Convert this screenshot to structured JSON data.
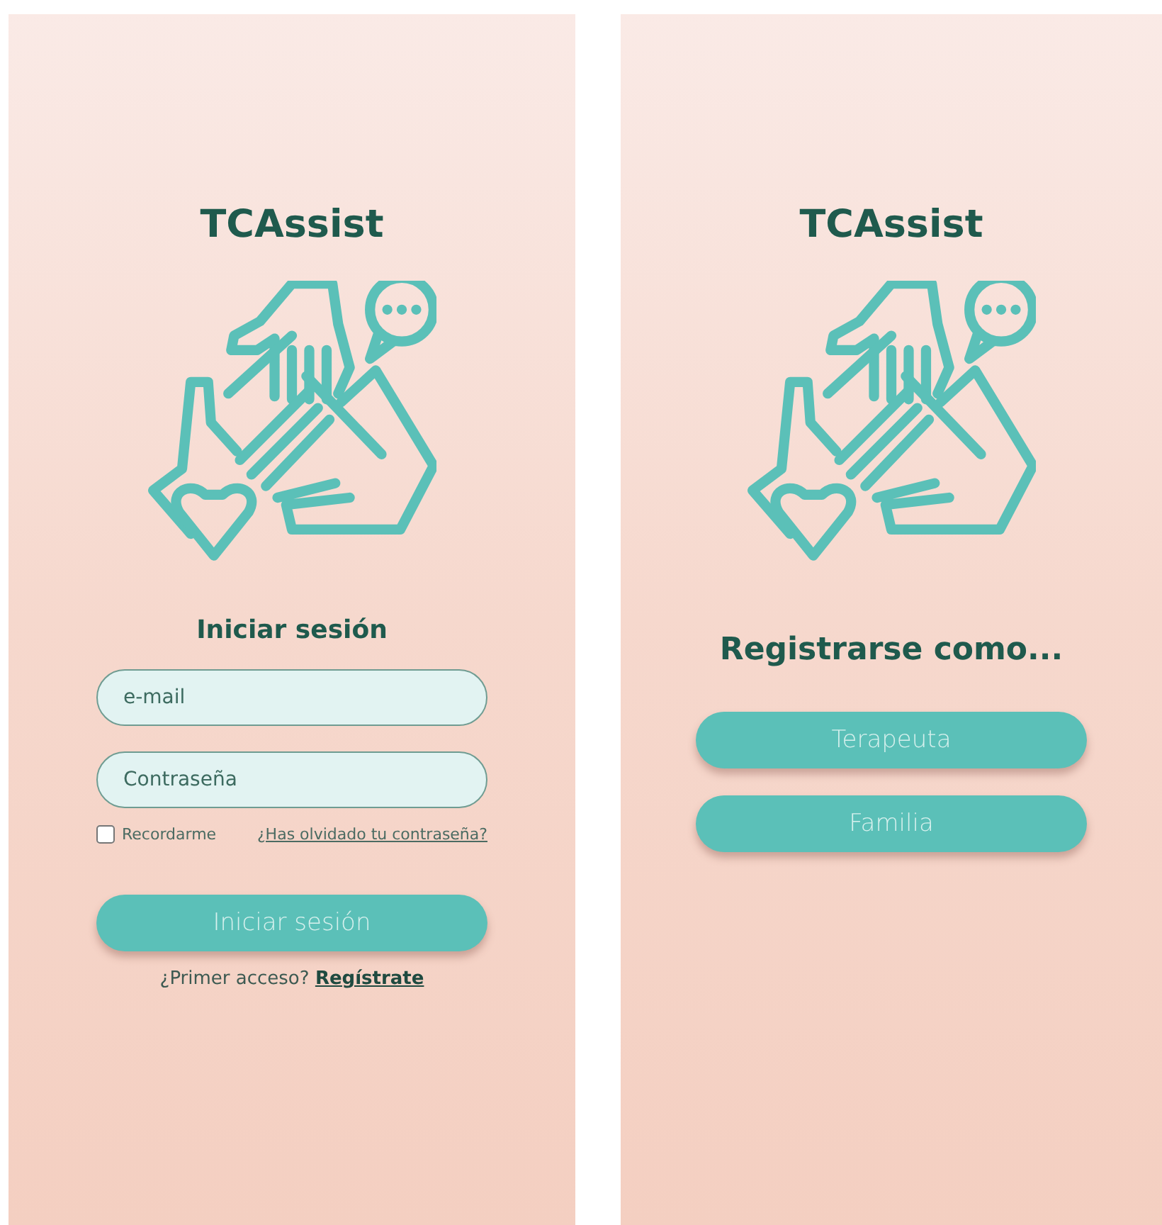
{
  "login": {
    "app_title": "TCAssist",
    "heading": "Iniciar sesión",
    "fields": [
      {
        "placeholder": "e-mail"
      },
      {
        "placeholder": "Contraseña"
      }
    ],
    "remember": {
      "label": "Recordarme",
      "checked": false
    },
    "forgot_link": "¿Has olvidado tu contraseña?",
    "submit": "Iniciar sesión",
    "register_prompt": "¿Primer acceso?",
    "register_link": "Regístrate"
  },
  "register": {
    "app_title": "TCAssist",
    "heading": "Registrarse como...",
    "options": [
      "Terapeuta",
      "Familia"
    ]
  }
}
